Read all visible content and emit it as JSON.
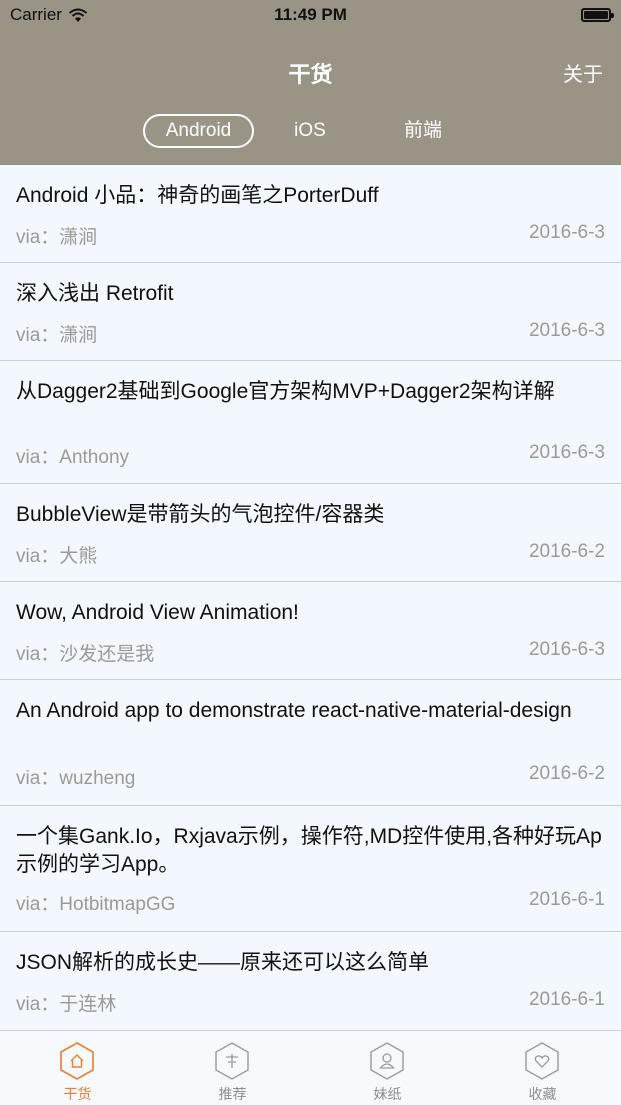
{
  "status_bar": {
    "carrier": "Carrier",
    "time": "11:49 PM"
  },
  "nav": {
    "title": "干货",
    "about_label": "关于",
    "tabs": [
      {
        "label": "Android"
      },
      {
        "label": "iOS"
      },
      {
        "label": "前端"
      }
    ],
    "active_tab": "Android"
  },
  "items": [
    {
      "title": "Android 小品：神奇的画笔之PorterDuff",
      "via": "via：潇涧",
      "date": "2016-6-3"
    },
    {
      "title": "深入浅出 Retrofit",
      "via": "via：潇涧",
      "date": "2016-6-3"
    },
    {
      "title": "从Dagger2基础到Google官方架构MVP+Dagger2架构详解",
      "via": "via：Anthony",
      "date": "2016-6-3"
    },
    {
      "title": "BubbleView是带箭头的气泡控件/容器类",
      "via": "via：大熊",
      "date": "2016-6-2"
    },
    {
      "title": "Wow, Android View Animation!",
      "via": "via：沙发还是我",
      "date": "2016-6-3"
    },
    {
      "title": "An Android app to demonstrate react-native-material-design",
      "via": "via：wuzheng",
      "date": "2016-6-2"
    },
    {
      "title": "一个集Gank.Io，Rxjava示例，操作符,MD控件使用,各种好玩Ap示例的学习App。",
      "via": "via：HotbitmapGG",
      "date": "2016-6-1"
    },
    {
      "title": "JSON解析的成长史——原来还可以这么简单",
      "via": "via：于连林",
      "date": "2016-6-1"
    }
  ],
  "tabbar": [
    {
      "label": "干货",
      "icon": "home-icon"
    },
    {
      "label": "推荐",
      "icon": "recommend-icon"
    },
    {
      "label": "妹纸",
      "icon": "girl-icon"
    },
    {
      "label": "收藏",
      "icon": "heart-icon"
    }
  ],
  "colors": {
    "nav_bg": "#9a9487",
    "active_tab": "#ef7b35",
    "list_bg": "#f2f8fd"
  }
}
